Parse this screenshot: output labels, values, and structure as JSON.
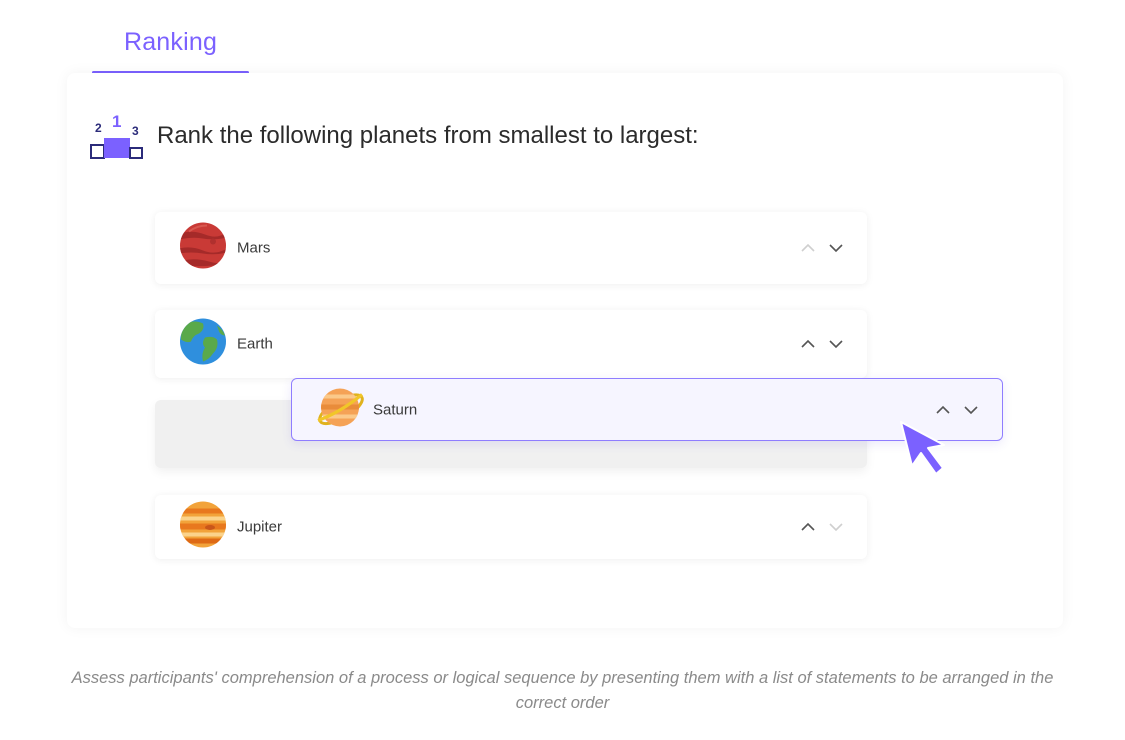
{
  "tab": {
    "label": "Ranking",
    "accent": "#7b61ff"
  },
  "question": {
    "text": "Rank the following planets from smallest to largest:",
    "icon": "podium-icon",
    "podium_numbers": [
      "2",
      "1",
      "3"
    ]
  },
  "items": [
    {
      "label": "Mars",
      "icon": "mars-planet-icon",
      "up_enabled": false,
      "down_enabled": true
    },
    {
      "label": "Earth",
      "icon": "earth-planet-icon",
      "up_enabled": true,
      "down_enabled": true
    },
    {
      "label": "Saturn",
      "icon": "saturn-planet-icon",
      "state": "dragging",
      "up_enabled": true,
      "down_enabled": true
    },
    {
      "label": "Jupiter",
      "icon": "jupiter-planet-icon",
      "up_enabled": true,
      "down_enabled": false
    }
  ],
  "caption": "Assess participants' comprehension of a process or logical sequence by presenting them with a list of statements to be arranged in the correct order"
}
